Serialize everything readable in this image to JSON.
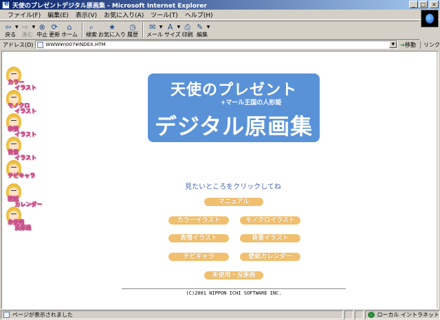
{
  "window": {
    "title": "天使のプレゼントデジタル原画集 - Microsoft Internet Explorer",
    "buttons": {
      "minimize": "_",
      "maximize": "□",
      "close": "×"
    }
  },
  "menubar": {
    "items": [
      "ファイル(F)",
      "編集(E)",
      "表示(V)",
      "お気に入り(A)",
      "ツール(T)",
      "ヘルプ(H)"
    ]
  },
  "toolbar": {
    "back": "戻る",
    "forward": "進む",
    "stop": "中止",
    "refresh": "更新",
    "home": "ホーム",
    "search": "検索",
    "favorites": "お気に入り",
    "history": "履歴",
    "mail": "メール",
    "size": "サイズ",
    "print": "印刷",
    "edit": "編集"
  },
  "address": {
    "label": "アドレス(D)",
    "url": "WWW¥n007¥INDEX.HTM",
    "go": "移動",
    "links": "リンク"
  },
  "sidebar": {
    "items": [
      {
        "line1": "カラー",
        "line2": "イラスト"
      },
      {
        "line1": "モノクロ",
        "line2": "イラスト"
      },
      {
        "line1": "表情",
        "line2": "イラスト"
      },
      {
        "line1": "背景",
        "line2": "イラスト"
      },
      {
        "line1": "チビキャラ",
        "line2": ""
      },
      {
        "line1": "壁紙",
        "line2": "カレンダー"
      },
      {
        "line1": "未使用",
        "line2": "没原画"
      }
    ]
  },
  "banner": {
    "title": "天使のプレゼント",
    "subtitle": "+マール王国の人形姫",
    "main": "デジタル原画集"
  },
  "main": {
    "prompt": "見たいところをクリックしてね",
    "links": {
      "manual": "マニュアル",
      "color": "カラーイラスト",
      "mono": "モノクロイラスト",
      "expression": "表情イラスト",
      "background": "背景イラスト",
      "chibi": "チビキャラ",
      "wallpaper": "壁紙カレンダー",
      "unused": "未使用・没原画"
    },
    "copyright": "(C)2001  NIPPON ICHI SOFTWARE INC."
  },
  "status": {
    "message": "ページが表示されました",
    "zone": "ローカル イントラネット"
  }
}
